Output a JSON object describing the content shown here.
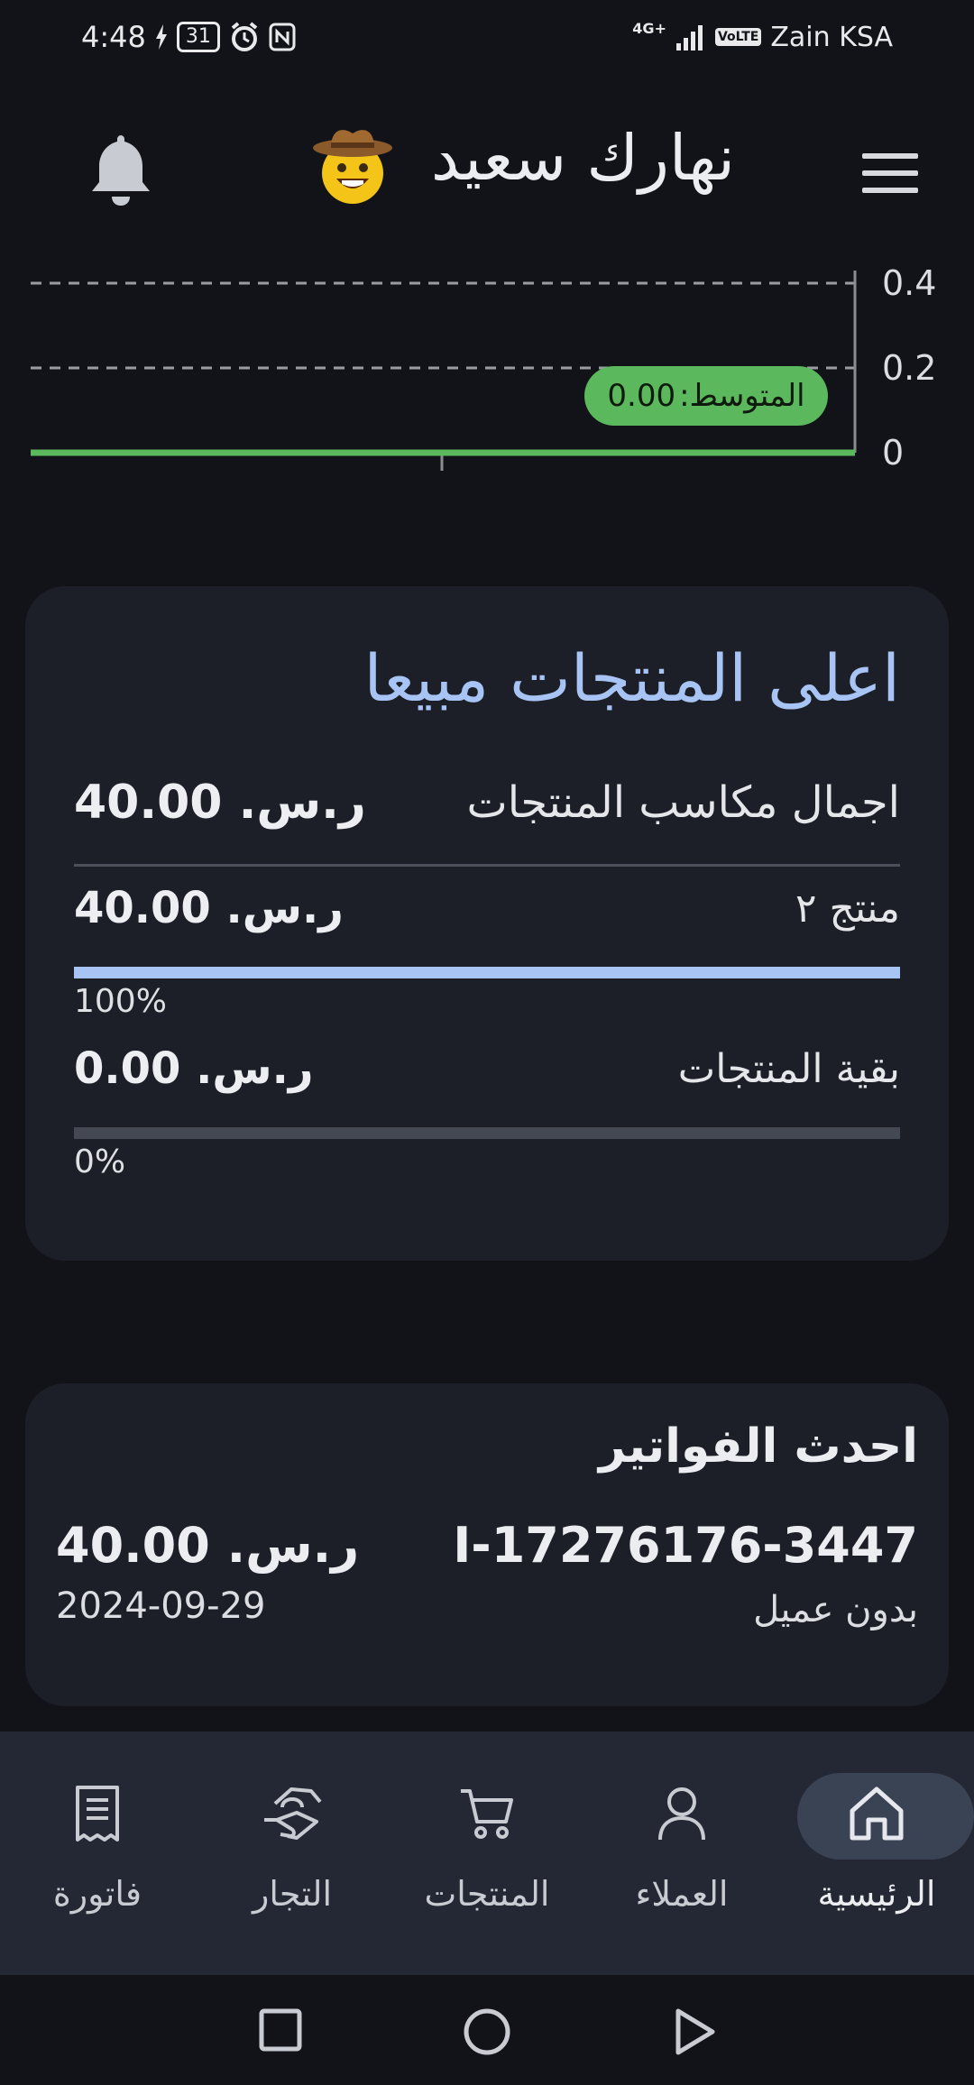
{
  "status_bar": {
    "time": "4:48",
    "battery": "31",
    "network": "4G+",
    "volte": "VoLTE",
    "carrier": "Zain KSA"
  },
  "header": {
    "greeting": "نهارك سعيد",
    "greeting_emoji": "cowboy-face"
  },
  "chart_data": {
    "type": "line",
    "y_ticks": [
      "0.4",
      "0.2",
      "0"
    ],
    "ylim": [
      0,
      0.4
    ],
    "series": [
      {
        "values": [
          0,
          0
        ]
      }
    ],
    "grid": true,
    "average_label": "المتوسط:",
    "average_value": "0.00",
    "line_color": "#5cb85c"
  },
  "top_products": {
    "title": "اعلى المنتجات مبيعا",
    "total_label": "اجمال مكاسب المنتجات",
    "total_amount": "ر.س. 40.00",
    "items": [
      {
        "name": "منتج ٢",
        "amount": "ر.س. 40.00",
        "percent_label": "100%",
        "percent": 1.0
      },
      {
        "name": "بقية المنتجات",
        "amount": "ر.س. 0.00",
        "percent_label": "0%",
        "percent": 0.0
      }
    ]
  },
  "invoices": {
    "title": "احدث الفواتير",
    "items": [
      {
        "id": "I-17276176-3447",
        "amount": "ر.س. 40.00",
        "customer": "بدون عميل",
        "date": "2024-09-29"
      }
    ]
  },
  "bottom_nav": {
    "items": [
      {
        "label": "فاتورة",
        "icon": "receipt-icon"
      },
      {
        "label": "التجار",
        "icon": "handshake-icon"
      },
      {
        "label": "المنتجات",
        "icon": "cart-icon"
      },
      {
        "label": "العملاء",
        "icon": "person-icon"
      },
      {
        "label": "الرئيسية",
        "icon": "home-icon",
        "active": true
      }
    ]
  },
  "colors": {
    "accent": "#a8c4f5",
    "background": "#111318",
    "card": "#1c1f28",
    "average_badge": "#5cb85c"
  }
}
